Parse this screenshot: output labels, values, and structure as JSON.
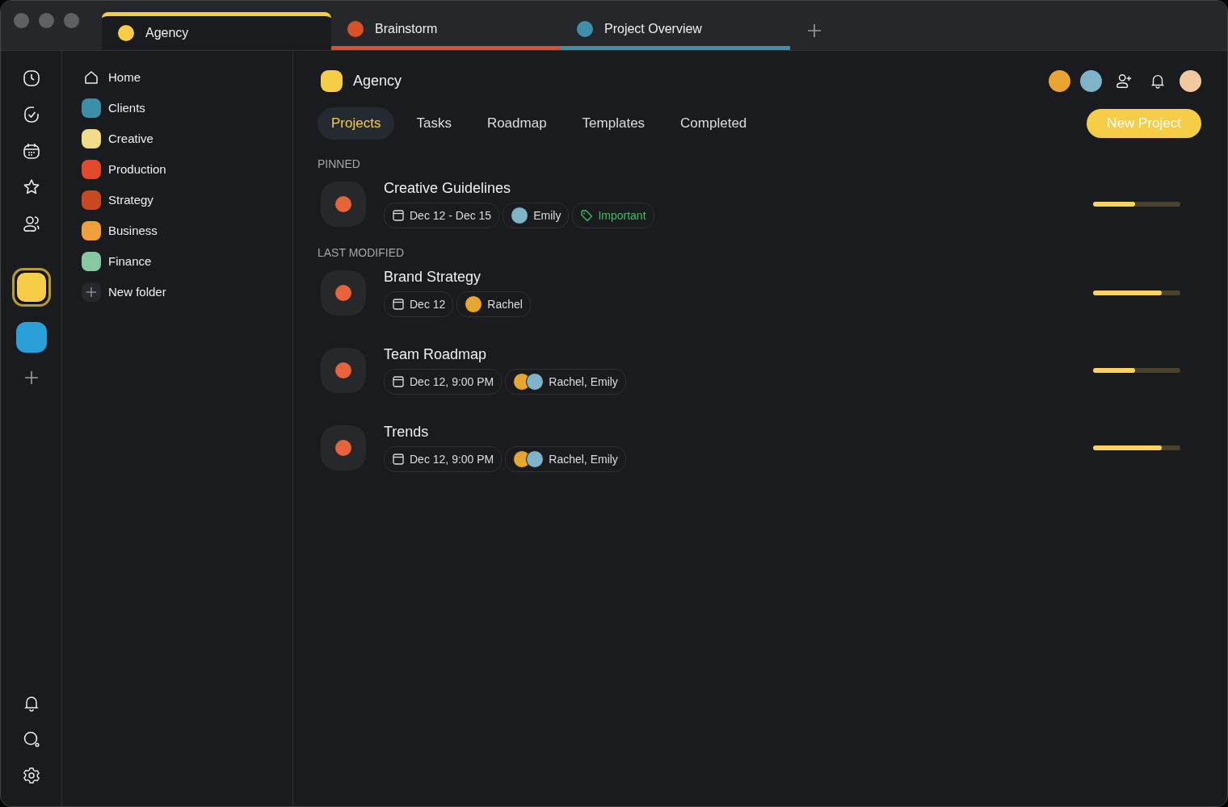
{
  "tabs": [
    {
      "label": "Agency",
      "selected": true,
      "color": "#f5cd47"
    },
    {
      "label": "Brainstorm",
      "selected": false,
      "color": "#d9502b"
    },
    {
      "label": "Project Overview",
      "selected": false,
      "color": "#3f8fa6"
    }
  ],
  "rail": {
    "spaces": [
      {
        "color": "#f5cd47",
        "selected": true
      },
      {
        "color": "#2a9fd8",
        "selected": false
      }
    ]
  },
  "sidebar": {
    "items": [
      {
        "label": "Home",
        "kind": "home"
      },
      {
        "label": "Clients",
        "kind": "folder",
        "color": "#3d8fa8"
      },
      {
        "label": "Creative",
        "kind": "folder",
        "color": "#f2dc8a"
      },
      {
        "label": "Production",
        "kind": "folder",
        "color": "#e04a2a"
      },
      {
        "label": "Strategy",
        "kind": "folder",
        "color": "#c9481f"
      },
      {
        "label": "Business",
        "kind": "folder",
        "color": "#f0a03a"
      },
      {
        "label": "Finance",
        "kind": "folder",
        "color": "#86c9a2"
      },
      {
        "label": "New folder",
        "kind": "add"
      }
    ]
  },
  "header": {
    "title": "Agency",
    "members": [
      {
        "color": "#e8a530"
      },
      {
        "color": "#7fb3c8"
      },
      {
        "color": "#f0c9a0"
      }
    ]
  },
  "views": [
    {
      "label": "Projects",
      "selected": true
    },
    {
      "label": "Tasks",
      "selected": false
    },
    {
      "label": "Roadmap",
      "selected": false
    },
    {
      "label": "Templates",
      "selected": false
    },
    {
      "label": "Completed",
      "selected": false
    }
  ],
  "new_project": "New Project",
  "sections": [
    {
      "title": "PINNED",
      "projects": [
        {
          "name": "Creative Guidelines",
          "date": "Dec 12 - Dec 15",
          "people": "Emily",
          "avatars": [
            {
              "color": "#7fb3c8"
            }
          ],
          "tag": "Important",
          "level": 0.48
        }
      ]
    },
    {
      "title": "LAST MODIFIED",
      "projects": [
        {
          "name": "Brand Strategy",
          "date": "Dec 12",
          "people": "Rachel",
          "avatars": [
            {
              "color": "#e8a530"
            }
          ],
          "level": 0.79
        },
        {
          "name": "Team Roadmap",
          "date": "Dec 12, 9:00 PM",
          "people": "Rachel, Emily",
          "avatars": [
            {
              "color": "#e8a530"
            },
            {
              "color": "#7fb3c8"
            }
          ],
          "level": 0.48
        },
        {
          "name": "Trends",
          "date": "Dec 12, 9:00 PM",
          "people": "Rachel, Emily",
          "avatars": [
            {
              "color": "#e8a530"
            },
            {
              "color": "#7fb3c8"
            }
          ],
          "level": 0.79
        }
      ]
    }
  ]
}
